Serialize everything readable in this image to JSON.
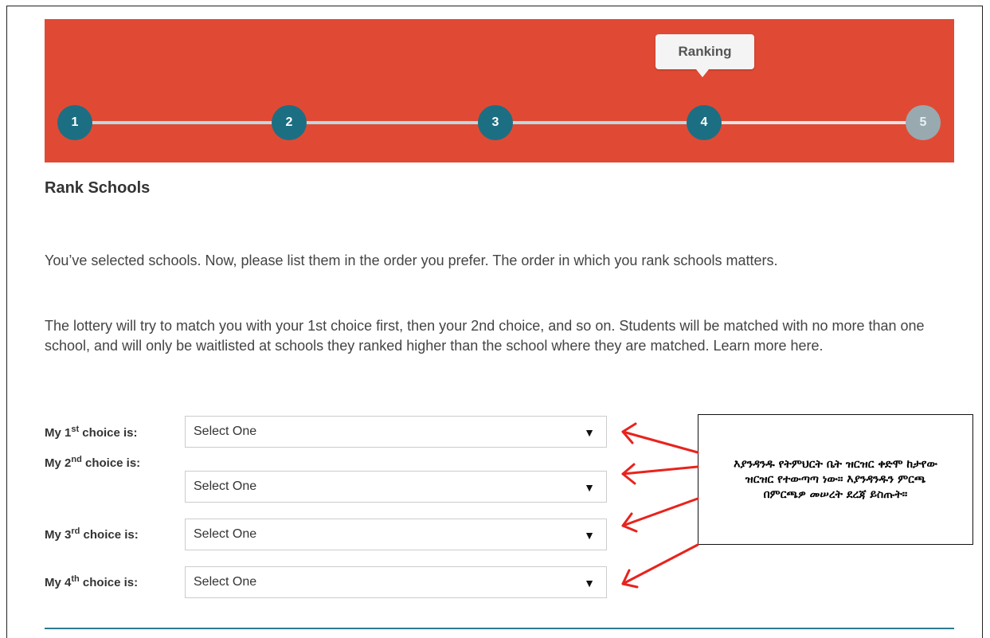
{
  "steps": [
    {
      "number": "1",
      "state": "done"
    },
    {
      "number": "2",
      "state": "done"
    },
    {
      "number": "3",
      "state": "done"
    },
    {
      "number": "4",
      "state": "current"
    },
    {
      "number": "5",
      "state": "upcoming"
    }
  ],
  "tooltip": "Ranking",
  "page_title": "Rank Schools",
  "paragraphs": {
    "p1": "You’ve selected schools. Now, please list them in the order you prefer. The order in which you rank schools matters.",
    "p2": "The lottery will try to match you with your 1st choice first, then your 2nd choice, and so on. Students will be matched with no more than one school, and will only be waitlisted at schools they ranked higher than the school where they are matched. Learn more here."
  },
  "choices": [
    {
      "prefix": "My 1",
      "ordinal": "st",
      "suffix": " choice is:",
      "value": "Select One"
    },
    {
      "prefix": "My 2",
      "ordinal": "nd",
      "suffix": " choice is:",
      "value": "Select One"
    },
    {
      "prefix": "My 3",
      "ordinal": "rd",
      "suffix": " choice is:",
      "value": "Select One"
    },
    {
      "prefix": "My 4",
      "ordinal": "th",
      "suffix": " choice is:",
      "value": "Select One"
    }
  ],
  "dropdown_caret": "▼",
  "annotation": "እያንዳንዱ የትምህርት ቤት ዝርዝር ቀድሞ ከታየው ዝርዝር የተውጣጣ ነው። እያንዳንዱን ምርጫ በምርጫዎ መሠረት ደረጃ ይስጡት።",
  "colors": {
    "banner": "#e04a34",
    "step_active": "#1c6f82",
    "step_inactive": "#98aab0",
    "arrow": "#e8231d",
    "rule": "#2a7d8f"
  }
}
